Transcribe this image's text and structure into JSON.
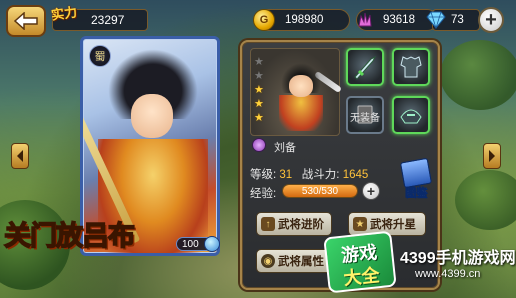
{
  "top_bar": {
    "power_label": "实力",
    "power_value": "23297",
    "gold_value": "198980",
    "gold_icon_glyph": "G",
    "crystal_value": "93618",
    "diamond_value": "73",
    "add_glyph": "+"
  },
  "hero_card": {
    "badge_glyph": "蜀",
    "title": "关门放吕布",
    "level_value": "100"
  },
  "hero_panel": {
    "stars_total": 5,
    "stars_filled": 3,
    "name": "刘备",
    "equipment": [
      {
        "icon": "sword-icon",
        "equipped": true
      },
      {
        "icon": "armor-icon",
        "equipped": true
      },
      {
        "icon": "book-icon",
        "equipped": false,
        "label": "无装备"
      },
      {
        "icon": "helmet-icon",
        "equipped": true
      }
    ],
    "level_label": "等级:",
    "level_value": "31",
    "power_label": "战斗力:",
    "power_value": "1645",
    "exp_label": "经验:",
    "exp_text": "530/530",
    "exp_fraction": 1.0,
    "exp_plus": "+",
    "handbook_label": "图鉴",
    "buttons": {
      "advance": "武将进阶",
      "upgrade_star": "武将升星",
      "attributes": "武将属性"
    }
  },
  "watermark": {
    "badge_line1": "游戏",
    "badge_line2": "大全",
    "site_name": "4399手机游戏网",
    "site_url": "www.4399.cn"
  }
}
